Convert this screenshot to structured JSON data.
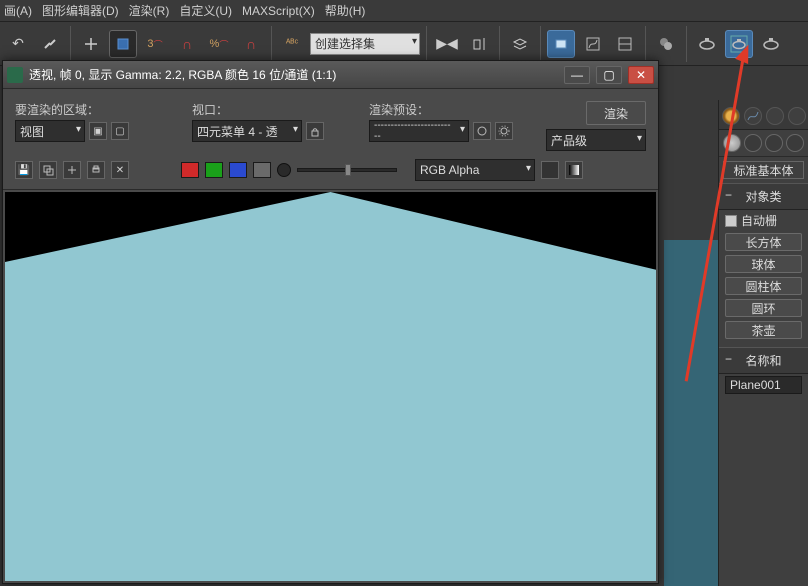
{
  "menu": {
    "items": [
      "画(A)",
      "图形编辑器(D)",
      "渲染(R)",
      "自定义(U)",
      "MAXScript(X)",
      "帮助(H)"
    ]
  },
  "toolbar": {
    "create_set": "创建选择集"
  },
  "right": {
    "std_primitives": "标准基本体",
    "obj_type_header": "对象类",
    "autogrid": "自动栅",
    "primitives": {
      "box": "长方体",
      "sphere": "球体",
      "cylinder": "圆柱体",
      "torus": "圆环",
      "teapot": "茶壶"
    },
    "name_header": "名称和",
    "object_name": "Plane001"
  },
  "render_win": {
    "title": "透视, 帧 0, 显示 Gamma: 2.2, RGBA 颜色 16 位/通道 (1:1)",
    "area_label": "要渲染的区域：",
    "area_value": "视图",
    "viewport_label": "视口：",
    "viewport_value": "四元菜单 4 - 透",
    "preset_label": "渲染预设：",
    "preset_value": "-------------------------",
    "render_btn": "渲染",
    "production": "产品级",
    "rgb_alpha": "RGB Alpha",
    "row2_btns": {
      "save": "save-icon",
      "clone": "clone-icon",
      "cross": "cross-icon",
      "print": "print-icon",
      "x": "close-x-icon"
    }
  },
  "colors": {
    "red": "#d02a2a",
    "green": "#1aa01a",
    "blue": "#2a4ad0",
    "gray": "#6a6a6a",
    "plane": "#91c7d1"
  }
}
